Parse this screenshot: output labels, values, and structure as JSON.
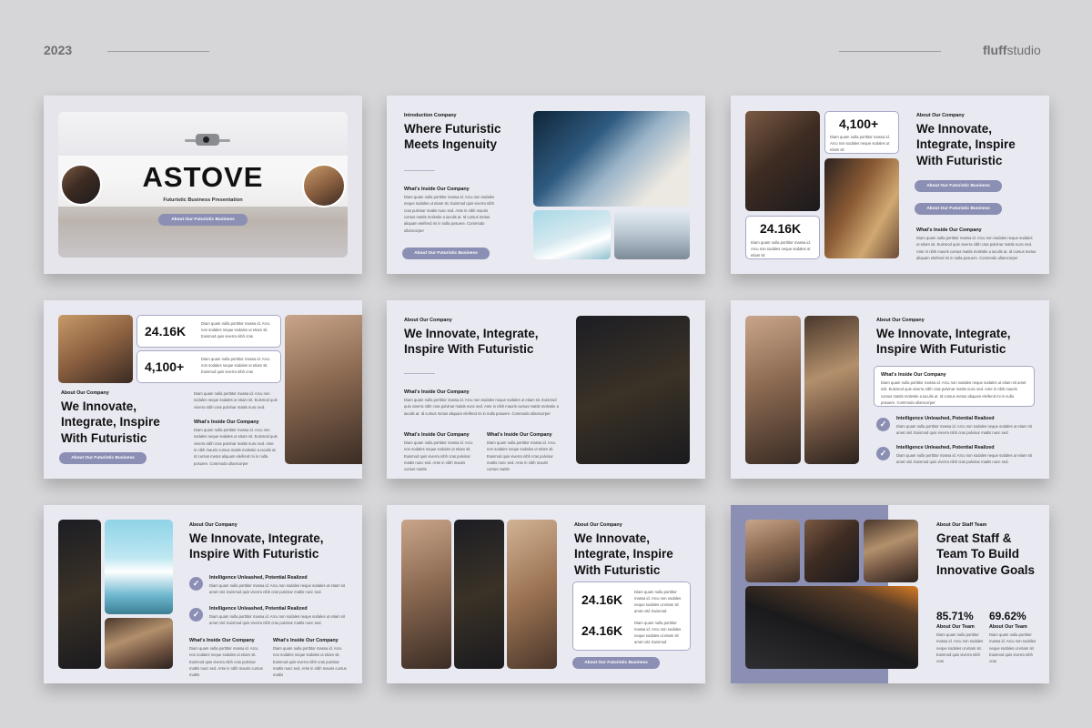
{
  "header": {
    "year": "2023",
    "brand_bold": "fluff",
    "brand_light": "studio"
  },
  "slide1": {
    "title": "ASTOVE",
    "subtitle": "Futuristic Business Presentation",
    "button": "About Our Futuristic Business"
  },
  "slide2": {
    "eyebrow": "Introduction Company",
    "title": "Where Futuristic Meets Ingenuity",
    "section_label": "What's Inside Our Company",
    "body": "Diam quam nulla porttitor massa id. Arcu non sodales neque sodales ut etiam sit. Euismod quis viverra nibh cras pulvinar mattis nunc sed. Ante in nibh mauris cursus mattis molestie a iaculis at. Id cursus metus aliquam eleifend mi in nulla posuere. Commodo ullamcorper",
    "button": "About Our Futuristic Business"
  },
  "slide3": {
    "stat1_num": "4,100+",
    "stat1_note": "Diam quam nulla porttitor massa id. Arcu non sodales neque sodales ut etiam sit",
    "stat2_num": "24.16K",
    "stat2_note": "Diam quam nulla porttitor massa id. Arcu non sodales neque sodales ut etiam sit",
    "eyebrow": "About Our Company",
    "title": "We Innovate, Integrate, Inspire With Futuristic",
    "button1": "About Our Futuristic Business",
    "button2": "About Our Futuristic Business",
    "section_label": "What's Inside Our Company",
    "body": "Diam quam nulla porttitor massa id. Arcu non sodales neque sodales ut etiam sit. Euismod quis viverra nibh cras pulvinar mattis nunc sed. Ante in nibh mauris cursus mattis molestie a iaculis at. Id cursus metus aliquam eleifend mi in nulla posuere. Commodo ullamcorper"
  },
  "slide4": {
    "stat1_num": "24.16K",
    "stat1_note": "Diam quam nulla porttitor massa id. Arcu non sodales neque sodales ut etiam sit. Euismod quis viverra nibh cras",
    "stat2_num": "4,100+",
    "stat2_note": "Diam quam nulla porttitor massa id. Arcu non sodales neque sodales ut etiam sit. Euismod quis viverra nibh cras",
    "eyebrow": "About Our Company",
    "title": "We Innovate, Integrate, Inspire With Futuristic",
    "intro": "Diam quam nulla porttitor massa id. Arcu non sodales neque sodales ut etiam sit. Euismod quis viverra nibh cras pulvinar mattis nunc sed.",
    "section_label": "What's Inside Our Company",
    "body": "Diam quam nulla porttitor massa id. Arcu non sodales neque sodales ut etiam sit. Euismod quis viverra nibh cras pulvinar mattis nunc sed. Ante in nibh mauris cursus mattis molestie a iaculis at. Id cursus metus aliquam eleifend mi in nulla posuere. Commodo ullamcorper",
    "button": "About Our Futuristic Business"
  },
  "slide5": {
    "eyebrow": "About Our Company",
    "title": "We Innovate, Integrate, Inspire With Futuristic",
    "section_label": "What's Inside Our Company",
    "body": "Diam quam nulla porttitor massa id. Arcu non sodales neque sodales ut etiam sit. Euismod quis viverra nibh cras pulvinar mattis nunc sed. Ante in nibh mauris cursus mattis molestie a iaculis at. Id cursus metus aliquam eleifend mi in nulla posuere. Commodo ullamcorper",
    "col1_label": "What's Inside Our Company",
    "col1_body": "Diam quam nulla porttitor massa id. Arcu non sodales neque sodales ut etiam sit. Euismod quis viverra nibh cras pulvinar mattis nunc sed. Ante in nibh mauris cursus mattis",
    "col2_label": "What's Inside Our Company",
    "col2_body": "Diam quam nulla porttitor massa id. Arcu non sodales neque sodales ut etiam sit. Euismod quis viverra nibh cras pulvinar mattis nunc sed. Ante in nibh mauris cursus mattis"
  },
  "slide6": {
    "eyebrow": "About Our Company",
    "title": "We Innovate, Integrate, Inspire With Futuristic",
    "box_label": "What's Inside Our Company",
    "box_body": "Diam quam nulla porttitor massa id. Arcu non sodales neque sodales ut etiam sit amet nisl. Euismod quis viverra nibh cras pulvinar mattis nunc sed. Ante in nibh mauris cursus mattis molestie a iaculis at. Id cursus metus aliquam eleifend mi in nulla posuere. Commodo ullamcorper",
    "item1_label": "Intelligence Unleashed, Potential Realized",
    "item1_body": "Diam quam nulla porttitor massa id. Arcu non sodales neque sodales ut etiam sit amet nisl. Euismod quis viverra nibh cras pulvinar mattis nunc sed.",
    "item2_label": "Intelligence Unleashed, Potential Realized",
    "item2_body": "Diam quam nulla porttitor massa id. Arcu non sodales neque sodales ut etiam sit amet nisl. Euismod quis viverra nibh cras pulvinar mattis nunc sed."
  },
  "slide7": {
    "eyebrow": "About Our Company",
    "title": "We Innovate, Integrate, Inspire With Futuristic",
    "item1_label": "Intelligence Unleashed, Potential Realized",
    "item1_body": "Diam quam nulla porttitor massa id. Arcu non sodales neque sodales ut etiam sit amet nisl. Euismod quis viverra nibh cras pulvinar mattis nunc sed.",
    "item2_label": "Intelligence Unleashed, Potential Realized",
    "item2_body": "Diam quam nulla porttitor massa id. Arcu non sodales neque sodales ut etiam sit amet nisl. Euismod quis viverra nibh cras pulvinar mattis nunc sed.",
    "col1_label": "What's Inside Our Company",
    "col1_body": "Diam quam nulla porttitor massa id. Arcu non sodales neque sodales ut etiam sit. Euismod quis viverra nibh cras pulvinar mattis nunc sed. Ante in nibh mauris cursus mattis",
    "col2_label": "What's Inside Our Company",
    "col2_body": "Diam quam nulla porttitor massa id. Arcu non sodales neque sodales ut etiam sit. Euismod quis viverra nibh cras pulvinar mattis nunc sed. Ante in nibh mauris cursus mattis"
  },
  "slide8": {
    "eyebrow": "About Our Company",
    "title": "We Innovate, Integrate, Inspire With Futuristic",
    "stat1_num": "24.16K",
    "stat1_note": "Diam quam nulla porttitor massa id. Arcu non sodales neque sodales ut etiam sit amet nisl. Euismod",
    "stat2_num": "24.16K",
    "stat2_note": "Diam quam nulla porttitor massa id. Arcu non sodales neque sodales ut etiam sit amet nisl. Euismod",
    "button": "About Our Futuristic Business"
  },
  "slide9": {
    "eyebrow": "About Our Staff Team",
    "title": "Great Staff & Team To Build Innovative Goals",
    "pct1": "85.71%",
    "pct1_label": "About Our Team",
    "pct1_body": "Diam quam nulla porttitor massa id. Arcu non sodales neque sodales ut etiam sit. Euismod quis viverra nibh cras",
    "pct2": "69.62%",
    "pct2_label": "About Our Team",
    "pct2_body": "Diam quam nulla porttitor massa id. Arcu non sodales neque sodales ut etiam sit. Euismod quis viverra nibh cras"
  }
}
